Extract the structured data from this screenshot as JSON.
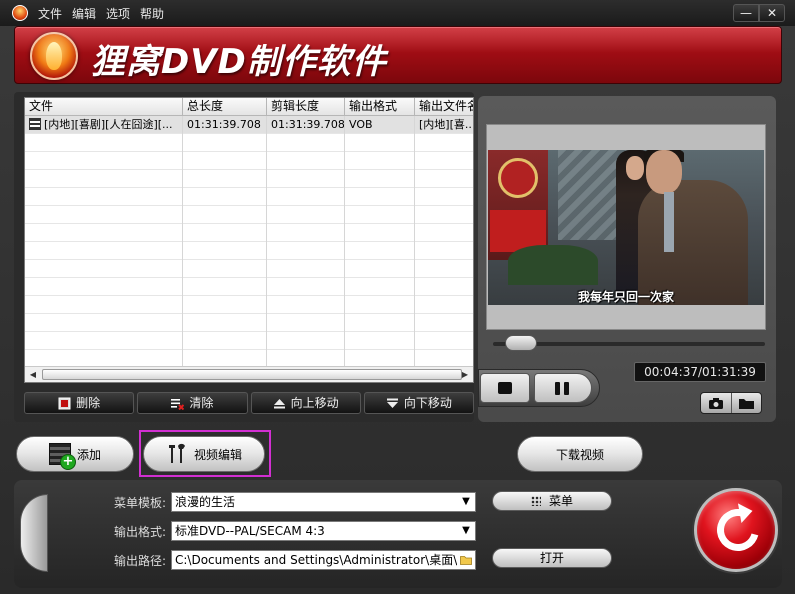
{
  "menubar": {
    "items": [
      "文件",
      "编辑",
      "选项",
      "帮助"
    ],
    "minimize": "—",
    "close": "✕"
  },
  "banner": {
    "title": "狸窝DVD制作软件"
  },
  "table": {
    "columns": [
      "文件",
      "总长度",
      "剪辑长度",
      "输出格式",
      "输出文件名"
    ],
    "rows": [
      {
        "file": "[内地][喜剧][人在囧途][...",
        "total": "01:31:39.708",
        "clip": "01:31:39.708",
        "format": "VOB",
        "output": "[内地][喜..."
      }
    ]
  },
  "list_toolbar": {
    "delete": "删除",
    "clear": "清除",
    "move_up": "向上移动",
    "move_down": "向下移动"
  },
  "preview": {
    "subtitle": "我每年只回一次家",
    "time": "00:04:37/01:31:39",
    "seek_fraction": 0.05
  },
  "actions": {
    "add": "添加",
    "video_edit": "视频编辑",
    "download": "下载视频"
  },
  "settings": {
    "menu_template_label": "菜单模板:",
    "menu_template_value": "浪漫的生活",
    "output_format_label": "输出格式:",
    "output_format_value": "标准DVD--PAL/SECAM 4:3",
    "output_path_label": "输出路径:",
    "output_path_value": "C:\\Documents and Settings\\Administrator\\桌面\\",
    "menu_button": "菜单",
    "open_button": "打开"
  },
  "colors": {
    "banner_red": "#b00f17",
    "highlight_magenta": "#d22fd2",
    "start_red": "#e0141e"
  }
}
